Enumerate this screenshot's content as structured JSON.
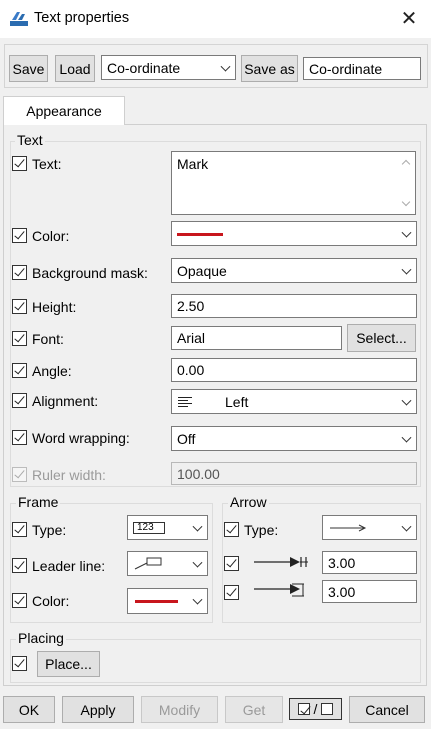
{
  "window": {
    "title": "Text properties",
    "icon": "app-icon",
    "close_icon": "close-icon"
  },
  "toolbar": {
    "save_label": "Save",
    "load_label": "Load",
    "preset_value": "Co-ordinate",
    "save_as_label": "Save as",
    "save_as_value": "Co-ordinate"
  },
  "tabs": [
    {
      "label": "Appearance"
    }
  ],
  "text_group": {
    "title": "Text",
    "text": {
      "label": "Text:",
      "value": "Mark"
    },
    "color": {
      "label": "Color:",
      "value_color": "#c8161d"
    },
    "background_mask": {
      "label": "Background mask:",
      "value": "Opaque"
    },
    "height": {
      "label": "Height:",
      "value": "2.50"
    },
    "font": {
      "label": "Font:",
      "value": "Arial",
      "select_label": "Select..."
    },
    "angle": {
      "label": "Angle:",
      "value": "0.00"
    },
    "alignment": {
      "label": "Alignment:",
      "value": "Left",
      "icon": "align-left-icon"
    },
    "word_wrapping": {
      "label": "Word wrapping:",
      "value": "Off"
    },
    "ruler_width": {
      "label": "Ruler width:",
      "value": "100.00"
    }
  },
  "frame_group": {
    "title": "Frame",
    "type": {
      "label": "Type:",
      "preview_text": "123"
    },
    "leader_line": {
      "label": "Leader line:",
      "icon": "leader-line-icon"
    },
    "color": {
      "label": "Color:",
      "value_color": "#c8161d"
    }
  },
  "arrow_group": {
    "title": "Arrow",
    "type": {
      "label": "Type:",
      "icon": "arrow-type-icon"
    },
    "length": {
      "icon": "arrow-length-icon",
      "value": "3.00"
    },
    "width": {
      "icon": "arrow-width-icon",
      "value": "3.00"
    }
  },
  "placing_group": {
    "title": "Placing",
    "place_label": "Place..."
  },
  "footer": {
    "ok_label": "OK",
    "apply_label": "Apply",
    "modify_label": "Modify",
    "get_label": "Get",
    "toggle_icon": "check-toggle-icon",
    "toggle_sep": "/",
    "cancel_label": "Cancel"
  }
}
